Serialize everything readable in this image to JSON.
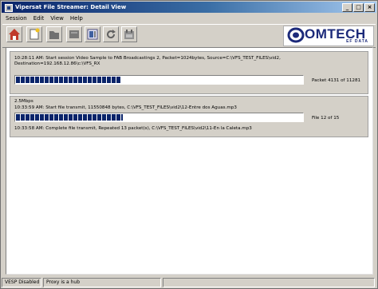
{
  "window": {
    "title": "Vipersat File Streamer: Detail View"
  },
  "menu": {
    "items": [
      "Session",
      "Edit",
      "View",
      "Help"
    ]
  },
  "toolbar": {
    "buttons": [
      {
        "icon": "home-icon"
      },
      {
        "icon": "new-file-icon"
      },
      {
        "icon": "open-folder-icon"
      },
      {
        "icon": "send-file-icon"
      },
      {
        "icon": "detail-view-icon"
      },
      {
        "icon": "refresh-icon"
      },
      {
        "icon": "schedule-icon"
      }
    ]
  },
  "logo": {
    "text": "OMTECH",
    "sub": "EF DATA"
  },
  "session1": {
    "line1": "10:28:11 AM: Start session Video Sample to FAB Broadcastings 2, Packet=1024bytes, Source=C:\\VFS_TEST_FILES\\vid2,",
    "line2": "Destination=192.168.12.86\\c:\\VFS_RX",
    "progress_label": "Packet 4131 of 11281",
    "progress_fraction": 0.366
  },
  "session2": {
    "rate": "2.5Mbps",
    "line1": "10:33:59 AM: Start file transmit, 11550848 bytes, C:\\VFS_TEST_FILES\\vid2\\12-Entre dos Aguas.mp3",
    "progress_label": "File 12 of 15",
    "progress_fraction": 0.37,
    "line2": "10:33:58 AM: Complete file transmit, Repeated 13 packet(s), C:\\VFS_TEST_FILES\\vid2\\11-En la Caleta.mp3"
  },
  "status": {
    "cell1": "VESP Disabled",
    "cell2": "Proxy is a hub",
    "cell3": ""
  },
  "colors": {
    "progress": "#0a246a",
    "logo": "#1c2a7a"
  }
}
